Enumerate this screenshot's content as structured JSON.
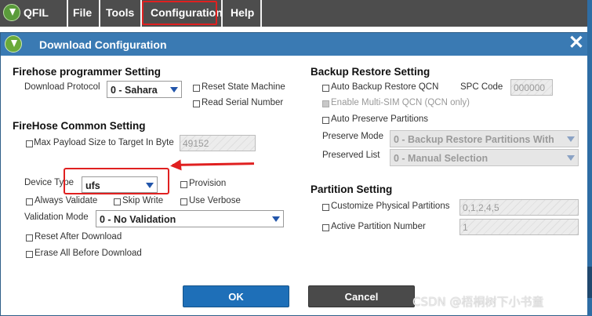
{
  "menubar": {
    "app_title": "QFIL",
    "items": [
      "File",
      "Tools",
      "Configuration",
      "Help"
    ],
    "highlighted": "Configuration",
    "highlight_color": "#e02020"
  },
  "dialog": {
    "title": "Download Configuration",
    "close_glyph": "✕",
    "firehose_programmer": {
      "heading": "Firehose programmer Setting",
      "download_protocol_label": "Download Protocol",
      "download_protocol_value": "0 - Sahara",
      "reset_state_machine": "Reset State Machine",
      "read_serial_number": "Read Serial Number"
    },
    "firehose_common": {
      "heading": "FireHose Common Setting",
      "max_payload_label": "Max Payload Size to Target In Byte",
      "max_payload_value": "49152",
      "device_type_label": "Device Type",
      "device_type_value": "ufs",
      "provision": "Provision",
      "always_validate": "Always Validate",
      "skip_write": "Skip Write",
      "use_verbose": "Use Verbose",
      "validation_mode_label": "Validation Mode",
      "validation_mode_value": "0 - No Validation",
      "reset_after_download": "Reset After Download",
      "erase_all_before_download": "Erase All Before Download"
    },
    "backup_restore": {
      "heading": "Backup Restore Setting",
      "auto_backup_restore_qcn": "Auto Backup Restore QCN",
      "spc_code_label": "SPC Code",
      "spc_code_value": "000000",
      "enable_multi_sim": "Enable Multi-SIM QCN (QCN only)",
      "auto_preserve_partitions": "Auto Preserve Partitions",
      "preserve_mode_label": "Preserve Mode",
      "preserve_mode_value": "0 - Backup Restore Partitions With",
      "preserved_list_label": "Preserved List",
      "preserved_list_value": "0 - Manual Selection"
    },
    "partition": {
      "heading": "Partition Setting",
      "customize_physical_partitions": "Customize Physical Partitions",
      "physical_partitions_value": "0,1,2,4,5",
      "active_partition_number": "Active Partition Number",
      "active_partition_value": "1"
    },
    "buttons": {
      "ok": "OK",
      "cancel": "Cancel"
    }
  },
  "watermark": "CSDN @梧桐树下小书童",
  "colors": {
    "menubar_bg": "#4d4d4d",
    "titlebar_bg": "#3a7ab3",
    "ok_button": "#1e6fb8",
    "cancel_button": "#4a4a4a",
    "annotation": "#e02020"
  },
  "icons": [
    "qfil-logo-icon",
    "download-config-icon",
    "close-icon",
    "dropdown-arrow-icon",
    "annotation-arrow-icon"
  ]
}
